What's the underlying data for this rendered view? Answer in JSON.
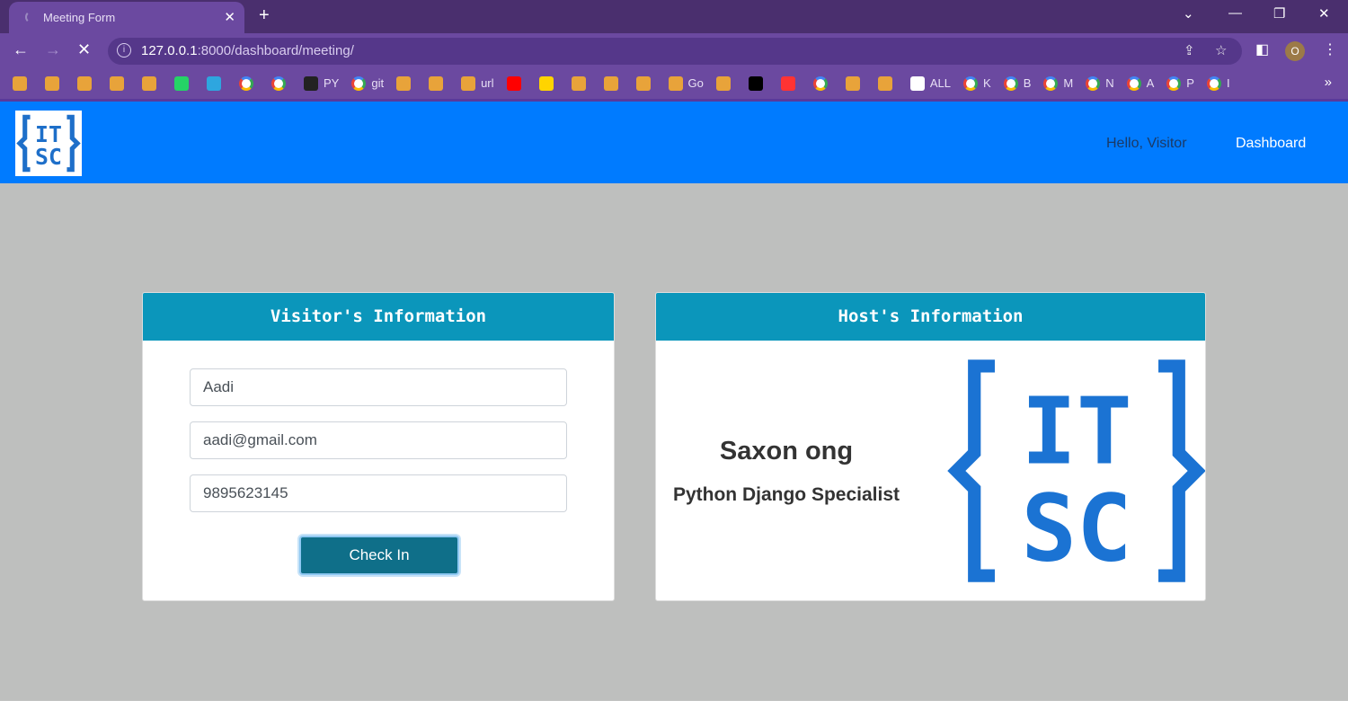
{
  "browser": {
    "tab_title": "Meeting Form",
    "url_host": "127.0.0.1",
    "url_rest": ":8000/dashboard/meeting/",
    "profile_initial": "O",
    "bookmarks": [
      {
        "icon": "bookmark-icon",
        "label": ""
      },
      {
        "icon": "bookmark-icon",
        "label": ""
      },
      {
        "icon": "bookmark-icon",
        "label": ""
      },
      {
        "icon": "analytics-icon",
        "label": ""
      },
      {
        "icon": "ieee-icon",
        "label": ""
      },
      {
        "icon": "whatsapp-icon",
        "label": ""
      },
      {
        "icon": "telegram-icon",
        "label": ""
      },
      {
        "icon": "google-icon",
        "label": ""
      },
      {
        "icon": "google-icon",
        "label": ""
      },
      {
        "icon": "github-icon",
        "label": "PY"
      },
      {
        "icon": "google-icon",
        "label": "git"
      },
      {
        "icon": "bookmark-icon",
        "label": ""
      },
      {
        "icon": "store-icon",
        "label": ""
      },
      {
        "icon": "wifi-icon",
        "label": "url"
      },
      {
        "icon": "youtube-icon",
        "label": ""
      },
      {
        "icon": "p-icon",
        "label": ""
      },
      {
        "icon": "camera-icon",
        "label": ""
      },
      {
        "icon": "cart-icon",
        "label": ""
      },
      {
        "icon": "circle-icon",
        "label": ""
      },
      {
        "icon": "bookmark-icon",
        "label": "Go"
      },
      {
        "icon": "duckduckgo-icon",
        "label": ""
      },
      {
        "icon": "cl-icon",
        "label": ""
      },
      {
        "icon": "yandex-icon",
        "label": ""
      },
      {
        "icon": "google-icon",
        "label": ""
      },
      {
        "icon": "matlab-icon",
        "label": ""
      },
      {
        "icon": "eye-icon",
        "label": ""
      },
      {
        "icon": "globe-icon",
        "label": "ALL"
      },
      {
        "icon": "google-icon",
        "label": "K"
      },
      {
        "icon": "google-icon",
        "label": "B"
      },
      {
        "icon": "google-icon",
        "label": "M"
      },
      {
        "icon": "google-icon",
        "label": "N"
      },
      {
        "icon": "google-icon",
        "label": "A"
      },
      {
        "icon": "google-icon",
        "label": "P"
      },
      {
        "icon": "google-icon",
        "label": "I"
      }
    ]
  },
  "navbar": {
    "logo_text": "IT SC",
    "greeting": "Hello, Visitor",
    "dashboard": "Dashboard"
  },
  "visitor": {
    "title": "Visitor's Information",
    "name": "Aadi",
    "email": "aadi@gmail.com",
    "phone": "9895623145",
    "submit": "Check In"
  },
  "host": {
    "title": "Host's Information",
    "name": "Saxon ong",
    "role": "Python Django Specialist",
    "logo_text": "IT SC"
  },
  "colors": {
    "navbar": "#007bff",
    "card_header": "#0b96bb",
    "button": "#0f6f89",
    "browser": "#6b49a0"
  }
}
